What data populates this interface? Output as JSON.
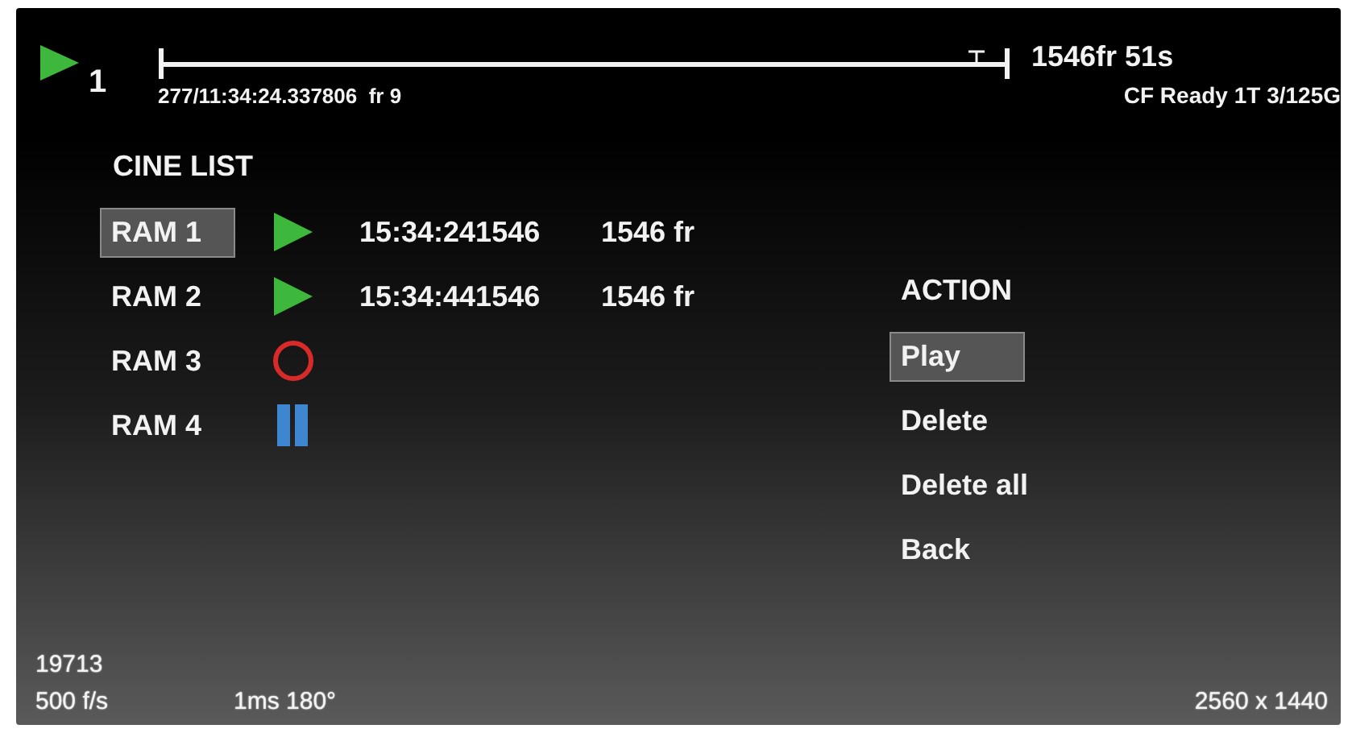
{
  "header": {
    "camera": "1",
    "position": "277/11:34:24.337806  fr 9",
    "length": "1546fr 51s",
    "storage": "CF Ready 1T 3/125G"
  },
  "cine_list": {
    "title": "CINE LIST",
    "items": [
      {
        "name": "RAM 1",
        "selected": true,
        "kind": "play",
        "timestamp": "15:34:241546",
        "frames": "1546 fr"
      },
      {
        "name": "RAM 2",
        "selected": false,
        "kind": "play",
        "timestamp": "15:34:441546",
        "frames": "1546 fr"
      },
      {
        "name": "RAM 3",
        "selected": false,
        "kind": "record"
      },
      {
        "name": "RAM 4",
        "selected": false,
        "kind": "pause"
      }
    ]
  },
  "action_menu": {
    "title": "ACTION",
    "items": [
      {
        "label": "Play",
        "selected": true
      },
      {
        "label": "Delete",
        "selected": false
      },
      {
        "label": "Delete all",
        "selected": false
      },
      {
        "label": "Back",
        "selected": false
      }
    ]
  },
  "status": {
    "counter": "19713",
    "frame_rate": "500 f/s",
    "shutter": "1ms 180°",
    "resolution": "2560 x 1440"
  }
}
